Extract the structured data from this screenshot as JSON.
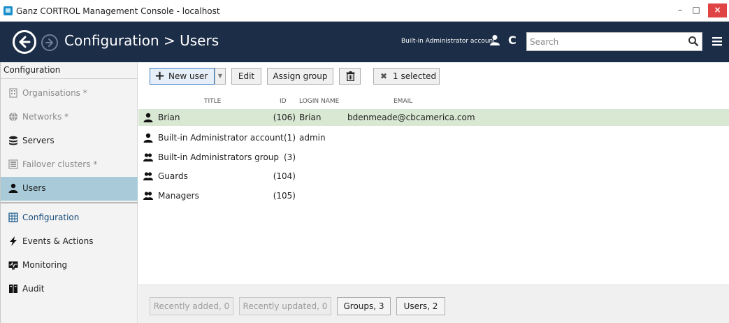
{
  "window": {
    "title": "Ganz CORTROL Management Console - localhost",
    "minimize_label": "–",
    "maximize_label": "□",
    "close_label": "×"
  },
  "header": {
    "page_title": "Configuration > Users",
    "account_label": "Built-in Administrator account",
    "refresh_glyph": "C",
    "search_placeholder": "Search"
  },
  "sidebar": {
    "section_title": "Configuration",
    "items": [
      {
        "label": "Organisations *",
        "icon": "organisation-icon",
        "disabled": true
      },
      {
        "label": "Networks *",
        "icon": "network-icon",
        "disabled": true
      },
      {
        "label": "Servers",
        "icon": "servers-icon",
        "disabled": false
      },
      {
        "label": "Failover clusters *",
        "icon": "failover-icon",
        "disabled": true
      },
      {
        "label": "Users",
        "icon": "user-icon",
        "disabled": false,
        "active": true
      }
    ],
    "nav": [
      {
        "label": "Configuration",
        "icon": "configuration-icon"
      },
      {
        "label": "Events & Actions",
        "icon": "lightning-icon"
      },
      {
        "label": "Monitoring",
        "icon": "monitoring-icon"
      },
      {
        "label": "Audit",
        "icon": "audit-icon"
      }
    ]
  },
  "toolbar": {
    "new_user_label": "New user",
    "edit_label": "Edit",
    "assign_group_label": "Assign group",
    "selected_label": "1 selected"
  },
  "table": {
    "columns": {
      "title": "TITLE",
      "id": "ID",
      "login": "LOGIN NAME",
      "email": "EMAIL"
    },
    "rows": [
      {
        "title": "Brian",
        "id": "(106)",
        "login": "Brian",
        "email": "bdenmeade@cbcamerica.com",
        "type": "user",
        "selected": true
      },
      {
        "title": "Built-in Administrator account",
        "id": "(1)",
        "login": "admin",
        "email": "",
        "type": "user",
        "selected": false
      },
      {
        "title": "Built-in Administrators group",
        "id": "(3)",
        "login": "",
        "email": "",
        "type": "group",
        "selected": false
      },
      {
        "title": "Guards",
        "id": "(104)",
        "login": "",
        "email": "",
        "type": "group",
        "selected": false
      },
      {
        "title": "Managers",
        "id": "(105)",
        "login": "",
        "email": "",
        "type": "group",
        "selected": false
      }
    ]
  },
  "footer": {
    "recently_added": "Recently added, 0",
    "recently_updated": "Recently updated, 0",
    "groups": "Groups, 3",
    "users": "Users, 2"
  },
  "colors": {
    "header_bg": "#1c2d47",
    "active_item_bg": "#a9cbd9",
    "selected_row_bg": "#d9e8d3",
    "close_button": "#e04343"
  }
}
